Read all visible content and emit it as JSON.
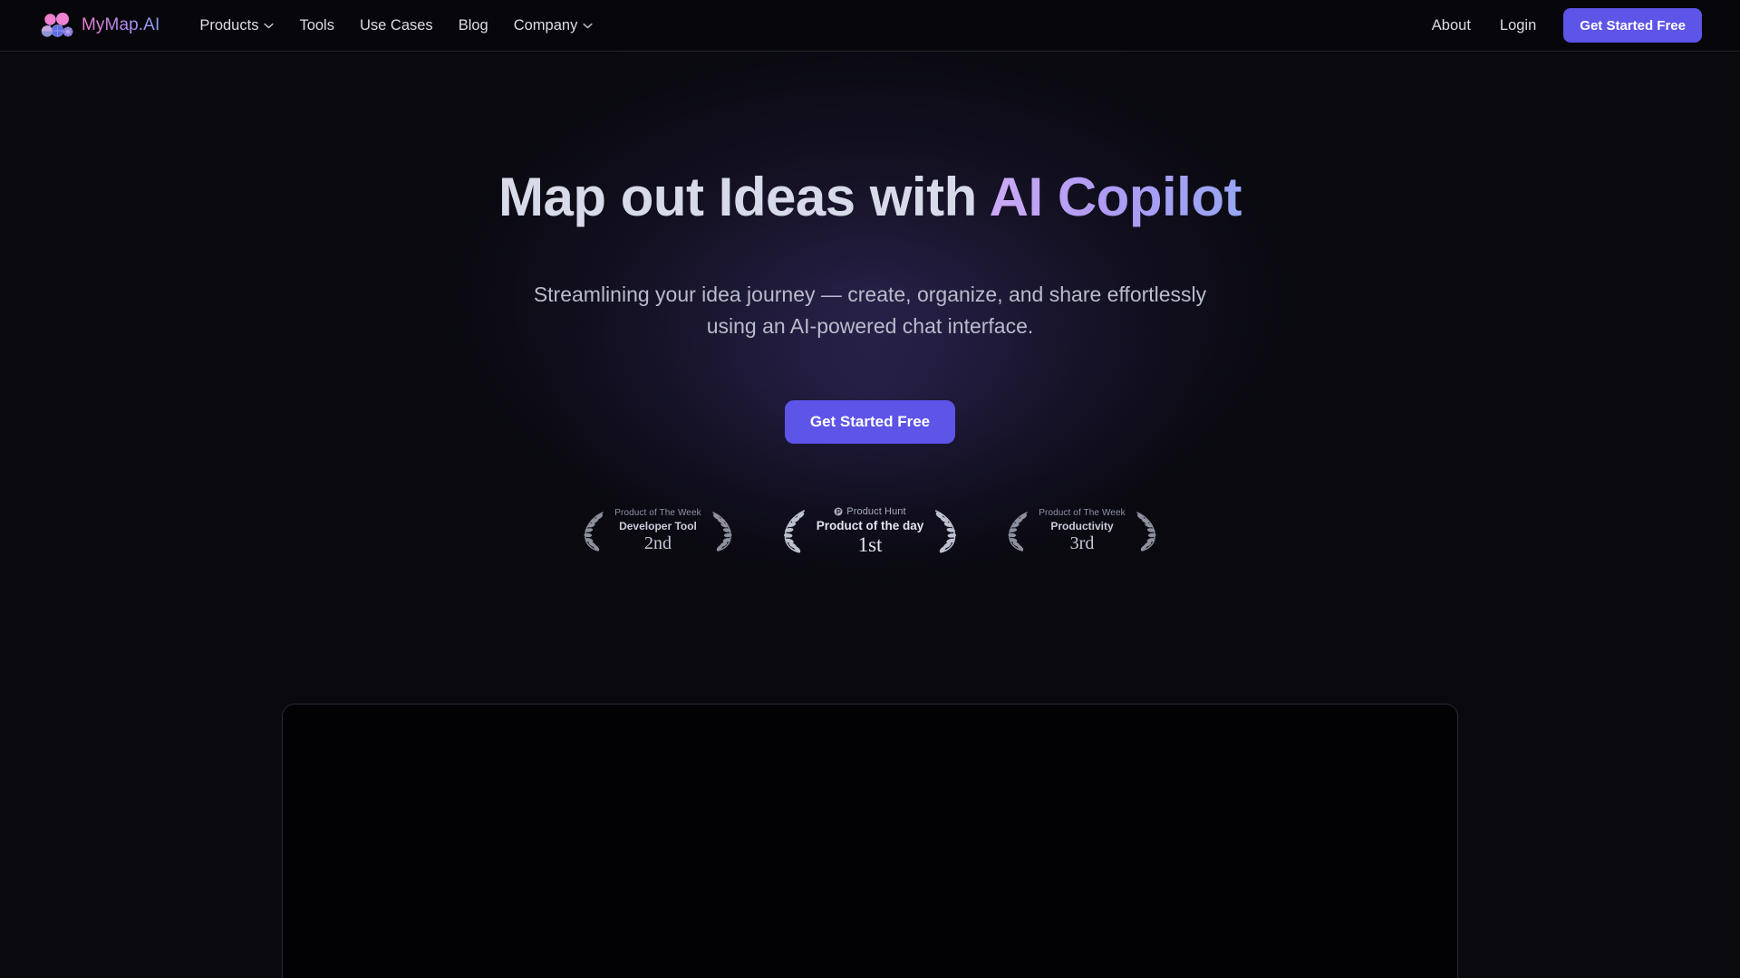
{
  "brand": {
    "name": "MyMap.AI",
    "logo_icon": "mymap-cluster-logo",
    "logo_colors": [
      "#f07fd0",
      "#b48cf0",
      "#6f7ae8"
    ]
  },
  "navbar": {
    "links": [
      {
        "label": "Products",
        "icon": "chevron-down-icon",
        "has_dropdown": true
      },
      {
        "label": "Tools",
        "icon": "",
        "has_dropdown": false
      },
      {
        "label": "Use Cases",
        "icon": "",
        "has_dropdown": false
      },
      {
        "label": "Blog",
        "icon": "",
        "has_dropdown": false
      },
      {
        "label": "Company",
        "icon": "chevron-down-icon",
        "has_dropdown": true
      }
    ],
    "right_links": [
      {
        "label": "About"
      },
      {
        "label": "Login"
      }
    ],
    "cta_label": "Get Started Free"
  },
  "hero": {
    "title_plain": "Map out Ideas with ",
    "title_accent": "AI Copilot",
    "subtitle": "Streamlining your idea journey — create, organize, and share effortlessly using an AI-powered chat interface.",
    "cta_label": "Get Started Free"
  },
  "awards": [
    {
      "top": "Product of The Week",
      "category": "Developer Tool",
      "rank": "2nd",
      "icon": "",
      "featured": false
    },
    {
      "top": "Product Hunt",
      "category": "Product of the day",
      "rank": "1st",
      "icon": "product-hunt-icon",
      "featured": true
    },
    {
      "top": "Product of The Week",
      "category": "Productivity",
      "rank": "3rd",
      "icon": "",
      "featured": false
    }
  ],
  "demo_panel": {
    "label": "product-demo-preview"
  },
  "colors": {
    "accent": "#5d54e8",
    "background": "#09090e",
    "navbar_bg": "#07070b",
    "title_text": "#d7dae8",
    "accent_text": "#b5a0f3",
    "body_text": "#b9bccb",
    "border": "#2a2a38"
  }
}
